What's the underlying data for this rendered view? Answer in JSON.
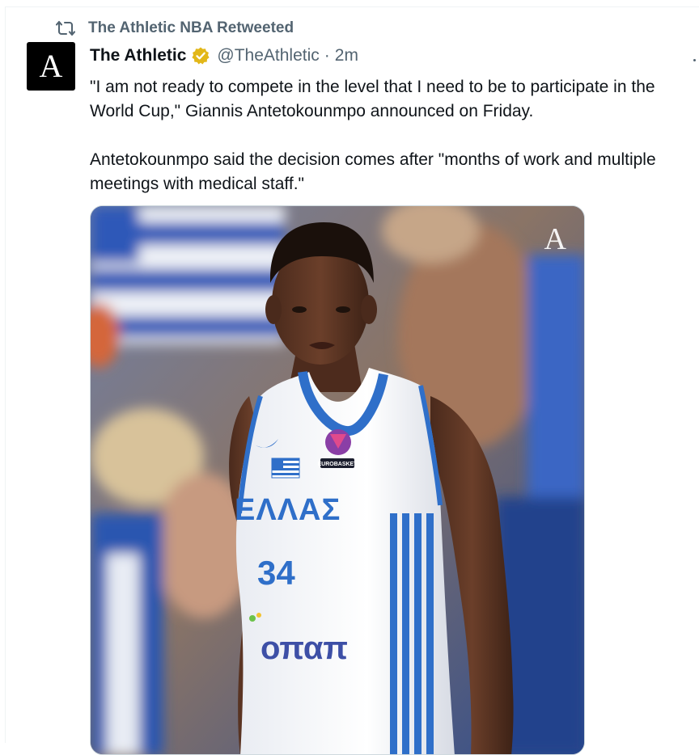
{
  "retweet": {
    "icon": "retweet-icon",
    "label": "The Athletic NBA Retweeted"
  },
  "author": {
    "avatar_letter": "A",
    "name": "The Athletic",
    "verified_icon": "verified-badge-icon",
    "verified_color": "#e2b719",
    "handle": "@TheAthletic",
    "separator": "·",
    "time": "2m"
  },
  "tweet": {
    "paragraphs": [
      "\"I am not ready to compete in the level that I need to be to participate in the World Cup,\" Giannis Antetokounmpo announced on Friday.",
      "Antetokounmpo said the decision comes after \"months of work and multiple meetings with medical staff.\""
    ]
  },
  "media": {
    "watermark": "A",
    "jersey_team": "ΕΛΛΑΣ",
    "jersey_number": "34",
    "jersey_sponsor": "οπαπ",
    "badge_text": "EUROBASKET"
  },
  "colors": {
    "text_primary": "#0f1419",
    "text_secondary": "#536471",
    "jersey_blue": "#2f6fc9"
  }
}
